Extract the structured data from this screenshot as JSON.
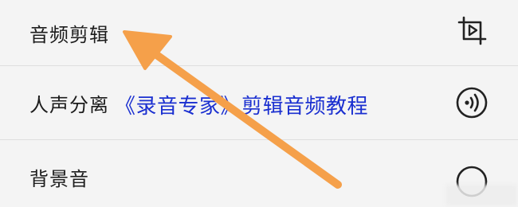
{
  "menu": {
    "items": [
      {
        "label": "音频剪辑",
        "icon": "crop-play-icon"
      },
      {
        "label": "人声分离",
        "icon": "audio-wave-icon"
      },
      {
        "label": "背景音",
        "icon": "music-icon"
      }
    ]
  },
  "overlay": {
    "title": "《录音专家》剪辑音频教程",
    "title_color": "#1a2fd0",
    "arrow_color": "#f5a04a"
  }
}
